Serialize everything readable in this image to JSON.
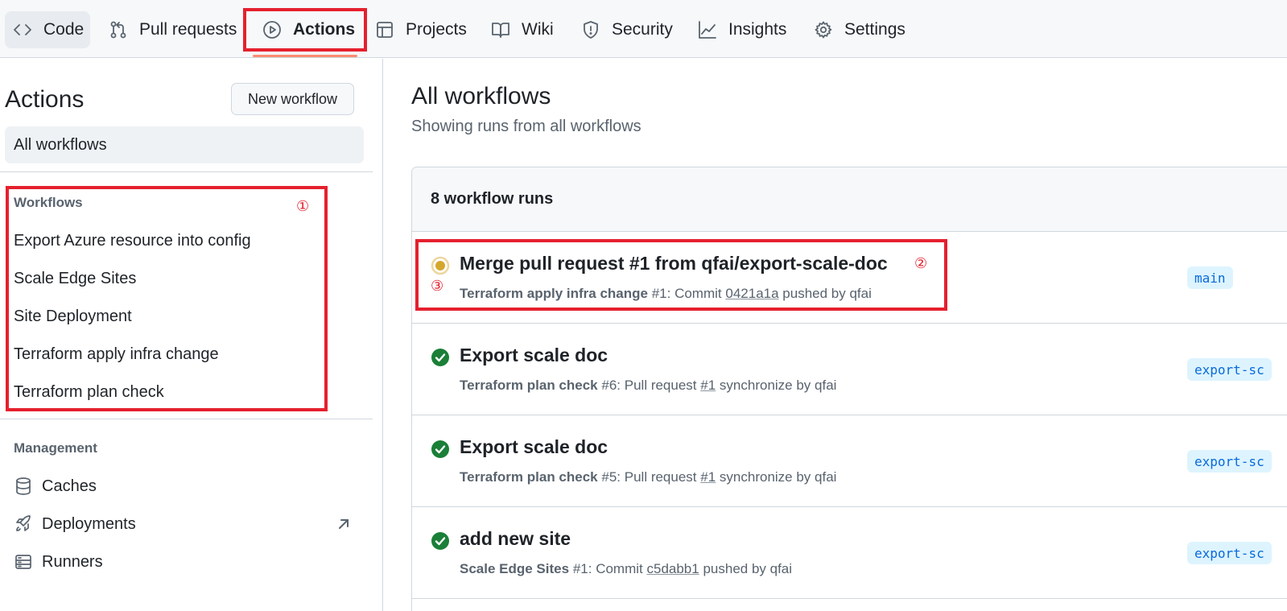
{
  "nav": {
    "tabs": [
      {
        "label": "Code",
        "icon": "code-icon"
      },
      {
        "label": "Pull requests",
        "icon": "git-pull-request-icon"
      },
      {
        "label": "Actions",
        "icon": "play-icon"
      },
      {
        "label": "Projects",
        "icon": "table-icon"
      },
      {
        "label": "Wiki",
        "icon": "book-icon"
      },
      {
        "label": "Security",
        "icon": "shield-icon"
      },
      {
        "label": "Insights",
        "icon": "graph-icon"
      },
      {
        "label": "Settings",
        "icon": "gear-icon"
      }
    ],
    "selected": "Actions"
  },
  "sidebar": {
    "title": "Actions",
    "new_workflow_label": "New workflow",
    "all_workflows_label": "All workflows",
    "workflows_heading": "Workflows",
    "workflows": [
      "Export Azure resource into config",
      "Scale Edge Sites",
      "Site Deployment",
      "Terraform apply infra change",
      "Terraform plan check"
    ],
    "management_heading": "Management",
    "management": [
      {
        "label": "Caches",
        "icon": "database-icon"
      },
      {
        "label": "Deployments",
        "icon": "rocket-icon"
      },
      {
        "label": "Runners",
        "icon": "server-icon"
      }
    ]
  },
  "annotations": {
    "one": "①",
    "two": "②",
    "three": "③",
    "color": "#e5202e"
  },
  "main": {
    "title": "All workflows",
    "subtitle": "Showing runs from all workflows",
    "runs_count_label": "8 workflow runs",
    "runs": [
      {
        "title": "Merge pull request #1 from qfai/export-scale-doc",
        "workflow": "Terraform apply infra change",
        "number": "#1",
        "event_text": "Commit",
        "ref": "0421a1a",
        "trailer": "pushed by qfai",
        "status": "in-progress",
        "branch": "main"
      },
      {
        "title": "Export scale doc",
        "workflow": "Terraform plan check",
        "number": "#6",
        "event_text": "Pull request",
        "ref": "#1",
        "trailer": "synchronize by qfai",
        "status": "success",
        "branch": "export-sc"
      },
      {
        "title": "Export scale doc",
        "workflow": "Terraform plan check",
        "number": "#5",
        "event_text": "Pull request",
        "ref": "#1",
        "trailer": "synchronize by qfai",
        "status": "success",
        "branch": "export-sc"
      },
      {
        "title": "add new site",
        "workflow": "Scale Edge Sites",
        "number": "#1",
        "event_text": "Commit",
        "ref": "c5dabb1",
        "trailer": "pushed by qfai",
        "status": "success",
        "branch": "export-sc"
      }
    ]
  },
  "colors": {
    "success": "#1a7f37",
    "in_progress": "#d4a72c",
    "accent_underline": "#fd8c73",
    "branch_bg": "#ddf4ff",
    "branch_fg": "#0969da"
  }
}
